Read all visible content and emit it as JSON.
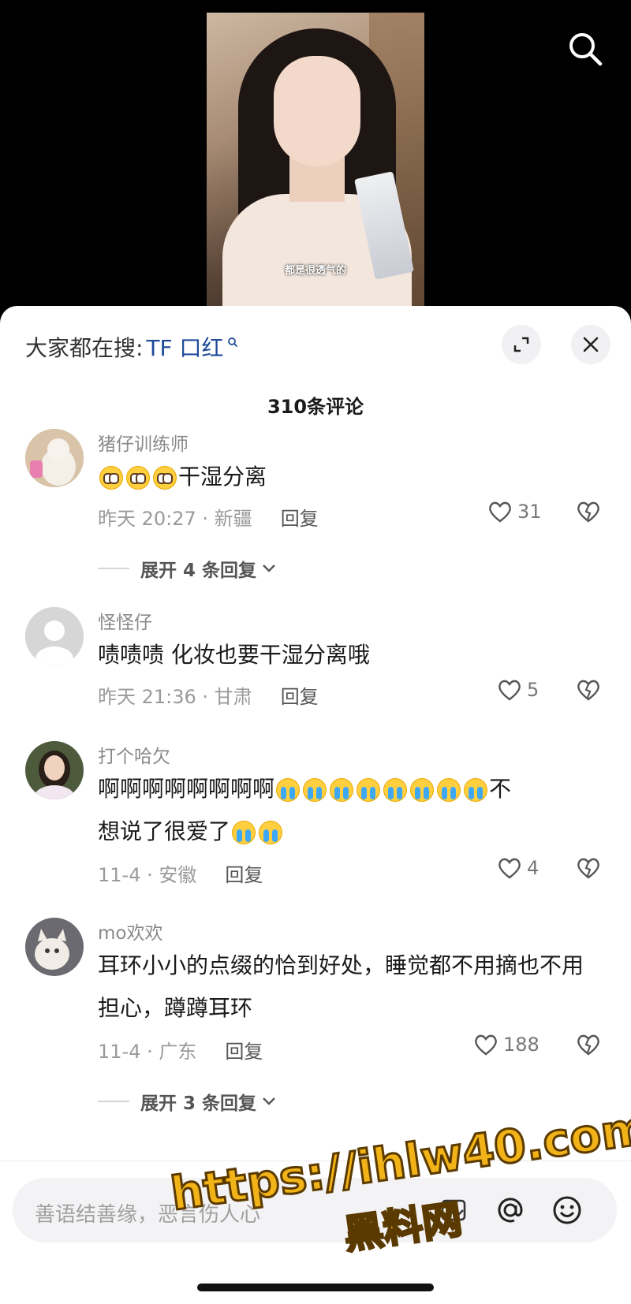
{
  "video": {
    "caption": "都是很透气的"
  },
  "header": {
    "trending_prefix": "大家都在搜:",
    "trending_keyword": "TF 口红",
    "expand_icon": "expand-icon",
    "close_icon": "close-icon"
  },
  "comment_count": "310条评论",
  "comments": [
    {
      "username": "猪仔训练师",
      "text": "干湿分离",
      "emoji_prefix": "plead-emoji x3",
      "meta": "昨天 20:27 · 新疆",
      "reply_label": "回复",
      "likes": "31",
      "expand_label": "展开 4 条回复"
    },
    {
      "username": "怪怪仔",
      "text": "啧啧啧 化妆也要干湿分离哦",
      "meta": "昨天 21:36 · 甘肃",
      "reply_label": "回复",
      "likes": "5"
    },
    {
      "username": "打个哈欠",
      "text_line1_a": "啊啊啊啊啊啊啊啊",
      "text_line1_b": "不",
      "text_line2": "想说了很爱了",
      "meta": "11-4 · 安徽",
      "reply_label": "回复",
      "likes": "4"
    },
    {
      "username": "mo欢欢",
      "text": "耳环小小的点缀的恰到好处，睡觉都不用摘也不用担心，蹲蹲耳环",
      "meta": "11-4 · 广东",
      "reply_label": "回复",
      "likes": "188",
      "expand_label": "展开 3 条回复"
    }
  ],
  "input": {
    "placeholder": "善语结善缘，恶言伤人心"
  },
  "watermark": {
    "line1": "https://ihlw40.com",
    "line2": "黑料网"
  },
  "colors": {
    "keyword": "#1e4a9a",
    "sheet_bg": "#ffffff",
    "watermark": "#f2b318"
  }
}
